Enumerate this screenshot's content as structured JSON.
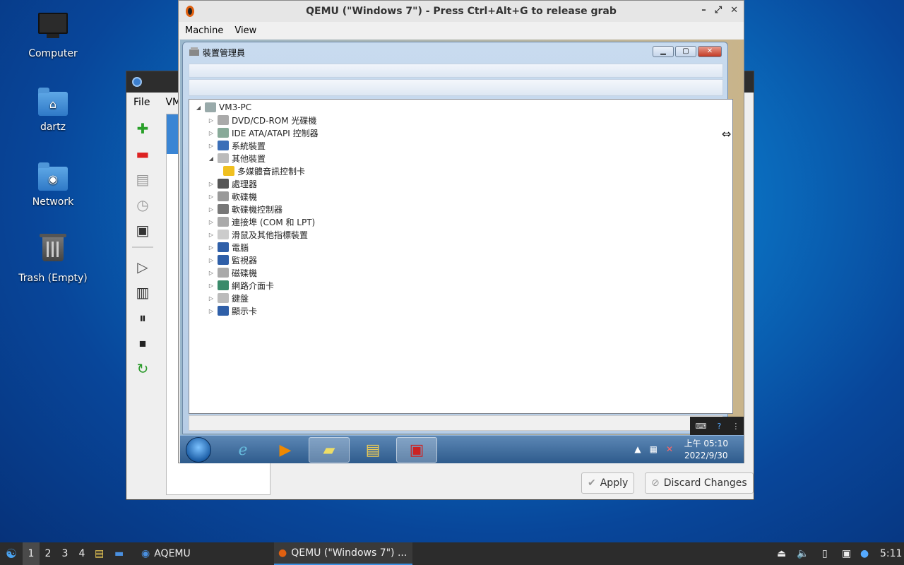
{
  "desktop": {
    "icons": [
      {
        "label": "Computer"
      },
      {
        "label": "dartz"
      },
      {
        "label": "Network"
      },
      {
        "label": "Trash (Empty)"
      }
    ]
  },
  "aqemu": {
    "menu": {
      "file": "File",
      "vm": "VM"
    },
    "apply_label": "Apply",
    "discard_label": "Discard Changes"
  },
  "qemu": {
    "title": "QEMU (\"Windows 7\") - Press Ctrl+Alt+G to release grab",
    "menu": {
      "machine": "Machine",
      "view": "View"
    }
  },
  "devmgr": {
    "title": "裝置管理員",
    "tree": {
      "root": "VM3-PC",
      "items": [
        {
          "label": "DVD/CD-ROM 光碟機"
        },
        {
          "label": "IDE ATA/ATAPI 控制器"
        },
        {
          "label": "系統裝置"
        },
        {
          "label": "其他裝置"
        },
        {
          "label": "多媒體音訊控制卡"
        },
        {
          "label": "處理器"
        },
        {
          "label": "軟碟機"
        },
        {
          "label": "軟碟機控制器"
        },
        {
          "label": "連接埠 (COM 和 LPT)"
        },
        {
          "label": "滑鼠及其他指標裝置"
        },
        {
          "label": "電腦"
        },
        {
          "label": "監視器"
        },
        {
          "label": "磁碟機"
        },
        {
          "label": "網路介面卡"
        },
        {
          "label": "鍵盤"
        },
        {
          "label": "顯示卡"
        }
      ]
    }
  },
  "win7_taskbar": {
    "clock_time": "上午 05:10",
    "clock_date": "2022/9/30"
  },
  "panel": {
    "workspaces": [
      "1",
      "2",
      "3",
      "4"
    ],
    "tasks": [
      "AQEMU",
      "QEMU (\"Windows 7\") ..."
    ],
    "clock": "5:11"
  },
  "colors": {
    "accent": "#3a8fe0",
    "devmgr_frame": "#b7cde6"
  }
}
